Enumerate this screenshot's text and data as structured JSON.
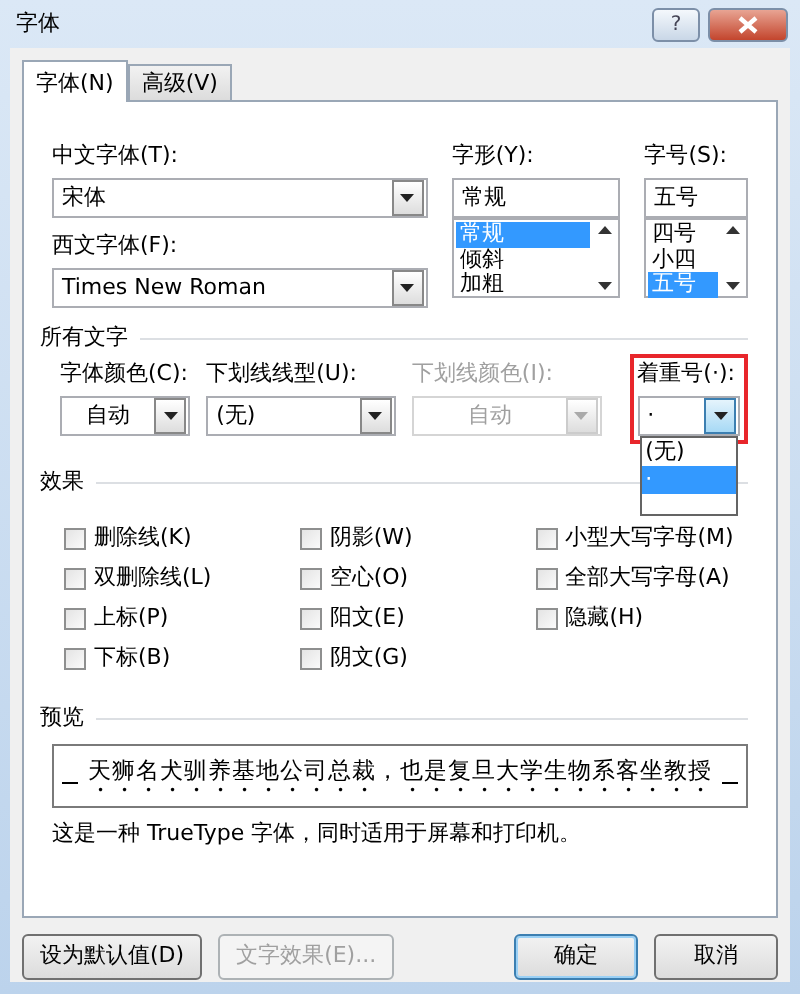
{
  "window": {
    "title": "字体",
    "help": "?"
  },
  "tabs": [
    {
      "label": "字体(N)",
      "selected": true
    },
    {
      "label": "高级(V)",
      "selected": false
    }
  ],
  "font": {
    "chinese": {
      "label": "中文字体(T):",
      "value": "宋体"
    },
    "western": {
      "label": "西文字体(F):",
      "value": "Times New Roman"
    },
    "style": {
      "label": "字形(Y):",
      "value": "常规",
      "options": [
        {
          "label": "常规",
          "selected": true
        },
        {
          "label": "倾斜",
          "selected": false
        },
        {
          "label": "加粗",
          "selected": false
        }
      ]
    },
    "size": {
      "label": "字号(S):",
      "value": "五号",
      "options": [
        {
          "label": "四号",
          "selected": false
        },
        {
          "label": "小四",
          "selected": false
        },
        {
          "label": "五号",
          "selected": true
        }
      ]
    }
  },
  "all_text": {
    "heading": "所有文字",
    "combos": [
      {
        "kind": "color",
        "label": "字体颜色(C):",
        "value": "自动",
        "disabled": false,
        "expanded": false,
        "highlighted": false
      },
      {
        "kind": "list",
        "label": "下划线线型(U):",
        "value": "(无)",
        "disabled": false,
        "expanded": false,
        "highlighted": false
      },
      {
        "kind": "color",
        "label": "下划线颜色(I):",
        "value": "自动",
        "disabled": true,
        "expanded": false,
        "highlighted": false
      },
      {
        "kind": "list",
        "label": "着重号(·):",
        "value": "·",
        "disabled": false,
        "expanded": true,
        "highlighted": true,
        "options": [
          {
            "label": "(无)",
            "selected": false
          },
          {
            "label": "·",
            "selected": true
          }
        ]
      }
    ]
  },
  "effects": {
    "heading": "效果",
    "columns": [
      [
        {
          "label": "删除线(K)",
          "checked": false
        },
        {
          "label": "双删除线(L)",
          "checked": false
        },
        {
          "label": "上标(P)",
          "checked": false
        },
        {
          "label": "下标(B)",
          "checked": false
        }
      ],
      [
        {
          "label": "阴影(W)",
          "checked": false
        },
        {
          "label": "空心(O)",
          "checked": false
        },
        {
          "label": "阳文(E)",
          "checked": false
        },
        {
          "label": "阴文(G)",
          "checked": false
        }
      ],
      [
        {
          "label": "小型大写字母(M)",
          "checked": false
        },
        {
          "label": "全部大写字母(A)",
          "checked": false
        },
        {
          "label": "隐藏(H)",
          "checked": false
        }
      ]
    ]
  },
  "preview": {
    "heading": "预览",
    "sample": "天狮名犬驯养基地公司总裁，也是复旦大学生物系客坐教授",
    "note": "这是一种 TrueType 字体，同时适用于屏幕和打印机。"
  },
  "buttons": [
    {
      "label": "设为默认值(D)",
      "disabled": false,
      "default": false
    },
    {
      "label": "文字效果(E)...",
      "disabled": true,
      "default": false
    },
    {
      "label": "确定",
      "disabled": false,
      "default": true
    },
    {
      "label": "取消",
      "disabled": false,
      "default": false
    }
  ]
}
